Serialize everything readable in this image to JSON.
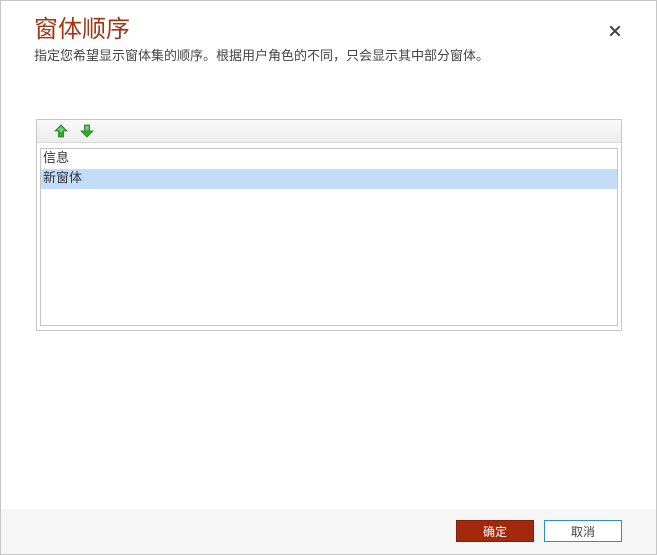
{
  "dialog": {
    "title": "窗体顺序",
    "description": "指定您希望显示窗体集的顺序。根据用户角色的不同，只会显示其中部分窗体。",
    "close_icon": "close-icon"
  },
  "toolbar": {
    "move_up_icon": "arrow-up-icon",
    "move_down_icon": "arrow-down-icon"
  },
  "form_list": {
    "items": [
      {
        "label": "信息",
        "selected": false
      },
      {
        "label": "新窗体",
        "selected": true
      }
    ]
  },
  "footer": {
    "ok_label": "确定",
    "cancel_label": "取消"
  },
  "colors": {
    "title": "#a33715",
    "ok_button": "#a4290c",
    "selected_row": "#c3dcf8",
    "arrow_green": "#3aa63a",
    "cancel_border": "#2a8dd4"
  }
}
